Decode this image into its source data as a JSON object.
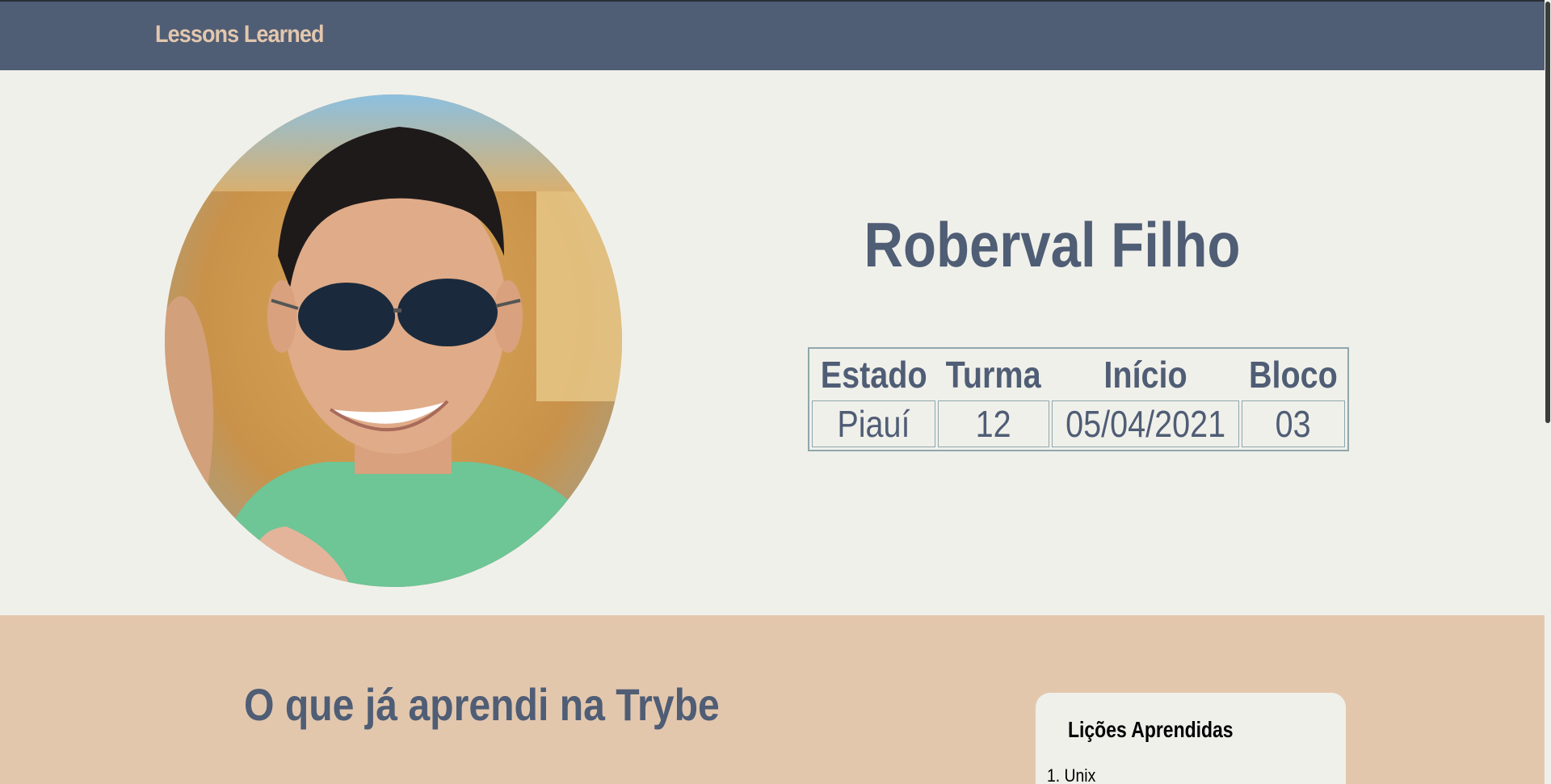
{
  "navbar": {
    "brand": "Lessons Learned"
  },
  "profile": {
    "name": "Roberval Filho",
    "photo_alt": "profile-photo"
  },
  "info_table": {
    "headers": [
      "Estado",
      "Turma",
      "Início",
      "Bloco"
    ],
    "values": [
      "Piauí",
      "12",
      "05/04/2021",
      "03"
    ]
  },
  "learned": {
    "title": "O que já aprendi na Trybe",
    "card_title": "Lições Aprendidas",
    "items": [
      "1. Unix"
    ]
  },
  "colors": {
    "navbar": "#4f5d75",
    "accent": "#e3c7ad",
    "background": "#f0f0ea",
    "text": "#4f5d75"
  }
}
